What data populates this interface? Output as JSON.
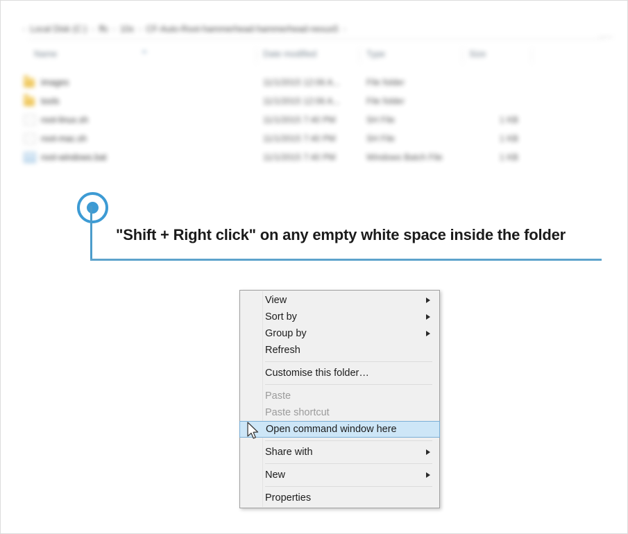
{
  "explorer": {
    "breadcrumb": {
      "leading_separator": "›",
      "crumbs": [
        "Local Disk (C:)",
        "ffs",
        "10x",
        "CF-Auto-Root-hammerhead-hammerhead-nexus5"
      ],
      "trailing_separator": "›",
      "separator": "›"
    },
    "columns": [
      "Name",
      "Date modified",
      "Type",
      "Size"
    ],
    "rows": [
      {
        "icon": "folder-icon",
        "name": "images",
        "date": "11/1/2015 12:06 A...",
        "type": "File folder",
        "size": ""
      },
      {
        "icon": "folder-icon",
        "name": "tools",
        "date": "11/1/2015 12:06 A...",
        "type": "File folder",
        "size": ""
      },
      {
        "icon": "file-icon",
        "name": "root-linux.sh",
        "date": "11/1/2015 7:40 PM",
        "type": "SH File",
        "size": "1 KB"
      },
      {
        "icon": "file-icon",
        "name": "root-mac.sh",
        "date": "11/1/2015 7:40 PM",
        "type": "SH File",
        "size": "1 KB"
      },
      {
        "icon": "batch-file-icon",
        "name": "root-windows.bat",
        "date": "11/1/2015 7:40 PM",
        "type": "Windows Batch File",
        "size": "1 KB"
      }
    ]
  },
  "callout": {
    "text": "\"Shift + Right click\" on any empty white space inside the folder",
    "accent_color": "#3d9bd4",
    "line_color": "#5ea3cc"
  },
  "context_menu": {
    "highlight_bg": "#cde6f7",
    "highlight_border": "#7aaed6",
    "items": [
      {
        "label": "View",
        "submenu": true,
        "disabled": false,
        "selected": false,
        "separator_after": false
      },
      {
        "label": "Sort by",
        "submenu": true,
        "disabled": false,
        "selected": false,
        "separator_after": false
      },
      {
        "label": "Group by",
        "submenu": true,
        "disabled": false,
        "selected": false,
        "separator_after": false
      },
      {
        "label": "Refresh",
        "submenu": false,
        "disabled": false,
        "selected": false,
        "separator_after": true
      },
      {
        "label": "Customise this folder…",
        "submenu": false,
        "disabled": false,
        "selected": false,
        "separator_after": true
      },
      {
        "label": "Paste",
        "submenu": false,
        "disabled": true,
        "selected": false,
        "separator_after": false
      },
      {
        "label": "Paste shortcut",
        "submenu": false,
        "disabled": true,
        "selected": false,
        "separator_after": false
      },
      {
        "label": "Open command window here",
        "submenu": false,
        "disabled": false,
        "selected": true,
        "separator_after": true
      },
      {
        "label": "Share with",
        "submenu": true,
        "disabled": false,
        "selected": false,
        "separator_after": true
      },
      {
        "label": "New",
        "submenu": true,
        "disabled": false,
        "selected": false,
        "separator_after": true
      },
      {
        "label": "Properties",
        "submenu": false,
        "disabled": false,
        "selected": false,
        "separator_after": false
      }
    ]
  }
}
